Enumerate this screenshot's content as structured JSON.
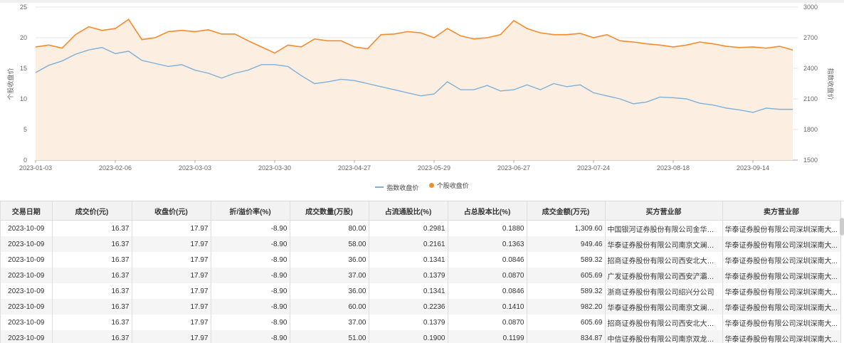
{
  "chart_data": {
    "type": "line",
    "x_tick_labels": [
      "2023-01-03",
      "2023-02-06",
      "2023-03-03",
      "2023-03-30",
      "2023-04-27",
      "2023-05-29",
      "2023-06-27",
      "2023-07-24",
      "2023-08-18",
      "2023-09-14"
    ],
    "points_per_tick": 6,
    "left_axis": {
      "label": "个股收盘价",
      "ylim": [
        0,
        25
      ],
      "ticks": [
        "0",
        "5",
        "10",
        "15",
        "20",
        "25"
      ]
    },
    "right_axis": {
      "label": "指数收盘价",
      "ylim": [
        1500,
        3000
      ],
      "ticks": [
        "1500",
        "1800",
        "2100",
        "2400",
        "2700",
        "3000"
      ]
    },
    "series": [
      {
        "name": "指数收盘价",
        "axis": "right",
        "color": "#7eb0d8",
        "values": [
          2358,
          2430,
          2472,
          2538,
          2580,
          2604,
          2544,
          2568,
          2478,
          2448,
          2418,
          2436,
          2382,
          2352,
          2304,
          2352,
          2382,
          2436,
          2436,
          2418,
          2328,
          2250,
          2268,
          2292,
          2280,
          2250,
          2220,
          2190,
          2160,
          2130,
          2148,
          2268,
          2190,
          2190,
          2232,
          2178,
          2190,
          2238,
          2190,
          2250,
          2220,
          2238,
          2160,
          2130,
          2100,
          2052,
          2070,
          2118,
          2112,
          2100,
          2058,
          2040,
          2010,
          1992,
          1968,
          2010,
          1998,
          1998
        ]
      },
      {
        "name": "个股收盘价",
        "axis": "left",
        "color": "#f68b2c",
        "area": true,
        "values": [
          18.5,
          18.8,
          18.3,
          20.5,
          21.8,
          21.2,
          21.5,
          23.0,
          19.7,
          20.0,
          21.0,
          21.2,
          21.0,
          21.3,
          20.6,
          20.6,
          19.5,
          18.5,
          17.5,
          18.8,
          18.5,
          19.8,
          19.5,
          19.5,
          18.5,
          18.2,
          20.5,
          20.6,
          21.0,
          20.8,
          20.0,
          21.5,
          20.3,
          19.8,
          20.0,
          20.5,
          22.8,
          21.5,
          20.8,
          20.5,
          20.5,
          20.7,
          20.0,
          20.5,
          19.5,
          19.3,
          19.0,
          18.8,
          18.5,
          18.8,
          19.3,
          19.0,
          18.6,
          18.4,
          18.5,
          18.3,
          18.6,
          18.0
        ]
      }
    ],
    "legend": "bottom-center"
  },
  "table": {
    "headers": [
      "交易日期",
      "成交价(元)",
      "收盘价(元)",
      "折/溢价率(%)",
      "成交数量(万股)",
      "占流通股比(%)",
      "占总股本比(%)",
      "成交金额(万元)",
      "买方营业部",
      "卖方营业部"
    ],
    "rows": [
      [
        "2023-10-09",
        "16.37",
        "17.97",
        "-8.90",
        "80.00",
        "0.2981",
        "0.1880",
        "1,309.60",
        "中国银河证券股份有限公司金华证...",
        "华泰证券股份有限公司深圳深南大..."
      ],
      [
        "2023-10-09",
        "16.37",
        "17.97",
        "-8.90",
        "58.00",
        "0.2161",
        "0.1363",
        "949.46",
        "华泰证券股份有限公司南京文澜路...",
        "华泰证券股份有限公司深圳深南大..."
      ],
      [
        "2023-10-09",
        "16.37",
        "17.97",
        "-8.90",
        "36.00",
        "0.1341",
        "0.0846",
        "589.32",
        "招商证券股份有限公司西安北大街...",
        "华泰证券股份有限公司深圳深南大..."
      ],
      [
        "2023-10-09",
        "16.37",
        "17.97",
        "-8.90",
        "37.00",
        "0.1379",
        "0.0870",
        "605.69",
        "广发证券股份有限公司西安浐灞大...",
        "华泰证券股份有限公司深圳深南大..."
      ],
      [
        "2023-10-09",
        "16.37",
        "17.97",
        "-8.90",
        "36.00",
        "0.1341",
        "0.0846",
        "589.32",
        "浙商证券股份有限公司绍兴分公司",
        "华泰证券股份有限公司深圳深南大..."
      ],
      [
        "2023-10-09",
        "16.37",
        "17.97",
        "-8.90",
        "60.00",
        "0.2236",
        "0.1410",
        "982.20",
        "华泰证券股份有限公司南京文澜路...",
        "华泰证券股份有限公司深圳深南大..."
      ],
      [
        "2023-10-09",
        "16.37",
        "17.97",
        "-8.90",
        "37.00",
        "0.1379",
        "0.0870",
        "605.69",
        "招商证券股份有限公司西安北大街...",
        "华泰证券股份有限公司深圳深南大..."
      ],
      [
        "2023-10-09",
        "16.37",
        "17.97",
        "-8.90",
        "51.00",
        "0.1900",
        "0.1199",
        "834.87",
        "中信证券股份有限公司南京双龙大...",
        "华泰证券股份有限公司深圳深南大..."
      ]
    ]
  }
}
